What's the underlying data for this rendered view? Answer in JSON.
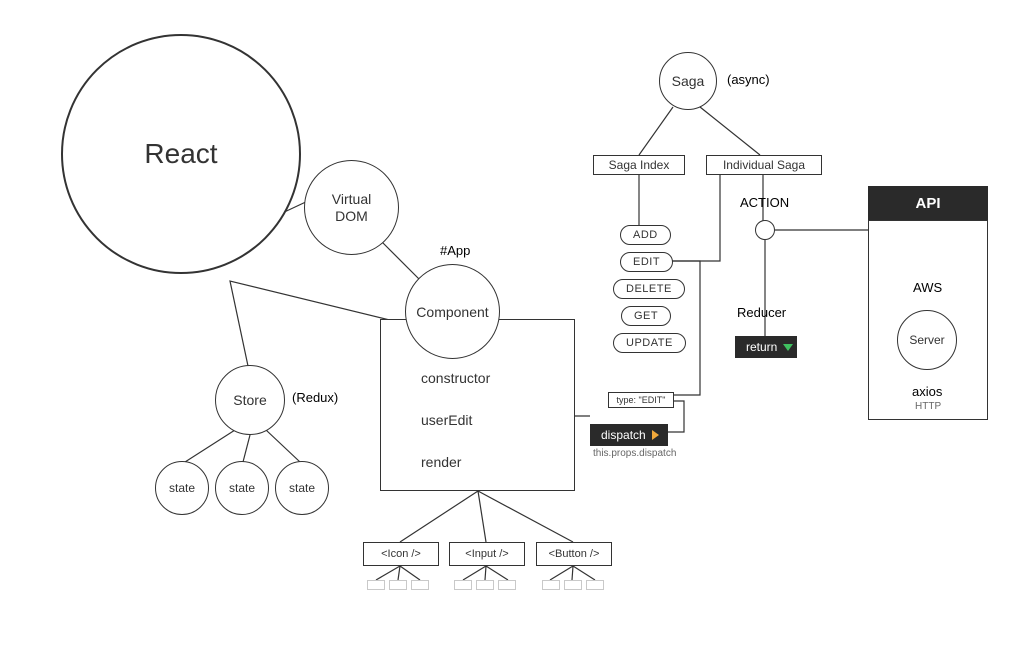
{
  "nodes": {
    "react": "React",
    "virtual_dom_line1": "Virtual",
    "virtual_dom_line2": "DOM",
    "app_hash": "#App",
    "component": "Component",
    "constructor": "constructor",
    "userEdit": "userEdit",
    "render": "render",
    "store": "Store",
    "redux_paren": "(Redux)",
    "state": "state",
    "children": {
      "icon": "<Icon />",
      "input": "<Input />",
      "button": "<Button />"
    }
  },
  "saga": {
    "title": "Saga",
    "async": "(async)",
    "index": "Saga Index",
    "individual": "Individual Saga",
    "actions": [
      "ADD",
      "EDIT",
      "DELETE",
      "GET",
      "UPDATE"
    ],
    "action_label": "ACTION",
    "reducer": "Reducer",
    "return": "return"
  },
  "dispatch": {
    "type_label": "type: \"EDIT\"",
    "dispatch": "dispatch",
    "caption": "this.props.dispatch"
  },
  "api": {
    "header": "API",
    "aws": "AWS",
    "server": "Server",
    "axios": "axios",
    "http": "HTTP"
  }
}
